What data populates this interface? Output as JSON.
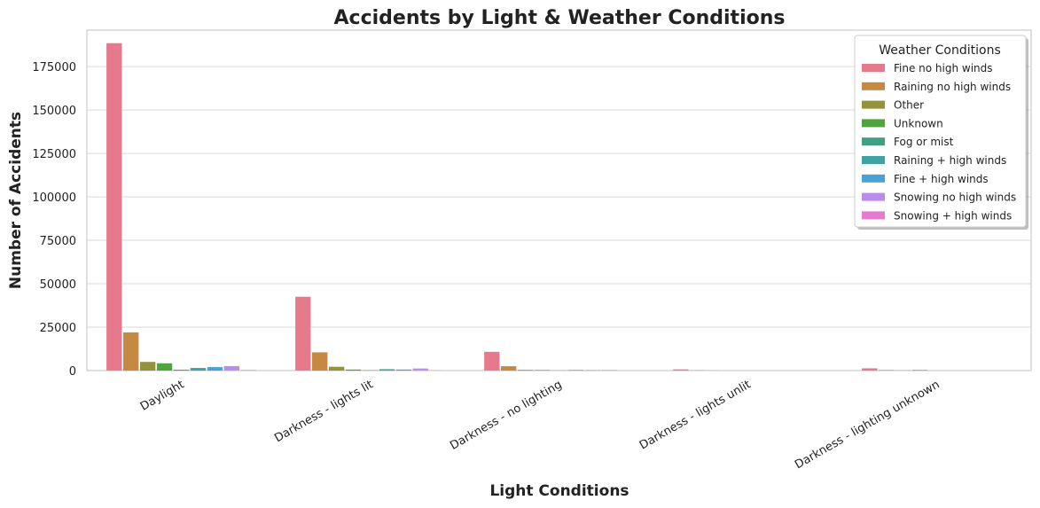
{
  "chart_data": {
    "type": "bar",
    "title": "Accidents by Light & Weather Conditions",
    "xlabel": "Light Conditions",
    "ylabel": "Number of Accidents",
    "categories": [
      "Daylight",
      "Darkness - lights lit",
      "Darkness - no lighting",
      "Darkness - lights unlit",
      "Darkness - lighting unknown"
    ],
    "ylim": [
      0,
      196000
    ],
    "yticks": [
      0,
      25000,
      50000,
      75000,
      100000,
      125000,
      150000,
      175000
    ],
    "grid": true,
    "legend": {
      "title": "Weather Conditions",
      "placement": "top-right"
    },
    "series": [
      {
        "name": "Fine no high winds",
        "color": "#e7798c",
        "values": [
          188500,
          42500,
          10800,
          700,
          1300
        ]
      },
      {
        "name": "Raining no high winds",
        "color": "#c58942",
        "values": [
          22000,
          10500,
          2500,
          150,
          300
        ]
      },
      {
        "name": "Other",
        "color": "#92923f",
        "values": [
          5000,
          2200,
          400,
          50,
          100
        ]
      },
      {
        "name": "Unknown",
        "color": "#4fa43d",
        "values": [
          4200,
          600,
          300,
          30,
          300
        ]
      },
      {
        "name": "Fog or mist",
        "color": "#3fa084",
        "values": [
          500,
          200,
          100,
          10,
          20
        ]
      },
      {
        "name": "Raining + high winds",
        "color": "#3fa1a1",
        "values": [
          1500,
          800,
          300,
          20,
          30
        ]
      },
      {
        "name": "Fine + high winds",
        "color": "#4aa1d6",
        "values": [
          2000,
          600,
          200,
          20,
          30
        ]
      },
      {
        "name": "Snowing no high winds",
        "color": "#bb8de9",
        "values": [
          2600,
          1200,
          300,
          30,
          50
        ]
      },
      {
        "name": "Snowing + high winds",
        "color": "#e57bcf",
        "values": [
          300,
          100,
          50,
          10,
          10
        ]
      }
    ]
  }
}
